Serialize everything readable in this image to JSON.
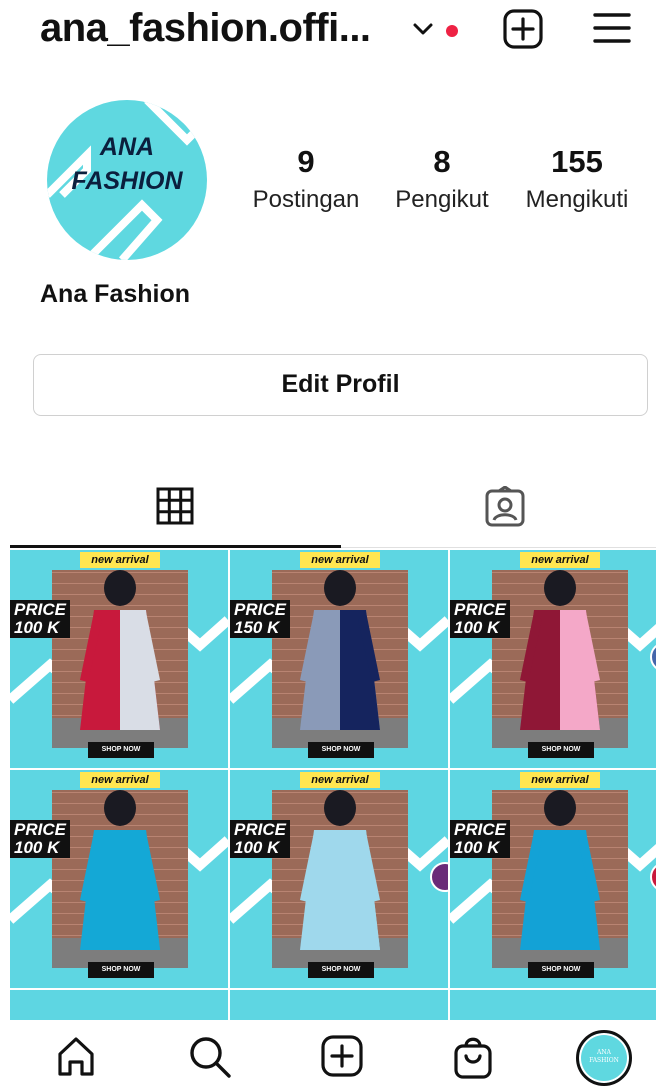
{
  "header": {
    "username": "ana_fashion.offi...",
    "chevron_icon": "chevron-down-icon",
    "notification_color": "#ee2244",
    "create_icon": "plus-square-icon",
    "menu_icon": "hamburger-menu-icon"
  },
  "profile": {
    "avatar_line1": "ANA",
    "avatar_line2": "FASHION",
    "avatar_color": "#5fd8e0",
    "display_name": "Ana Fashion",
    "stats": {
      "posts_count": "9",
      "posts_label": "Postingan",
      "followers_count": "8",
      "followers_label": "Pengikut",
      "following_count": "155",
      "following_label": "Mengikuti"
    },
    "edit_button": "Edit Profil"
  },
  "tabs": [
    {
      "icon": "grid-icon",
      "active": true
    },
    {
      "icon": "tagged-person-icon",
      "active": false
    }
  ],
  "posts": [
    {
      "badge": "new arrival",
      "price_line1": "PRICE",
      "price_line2": "100 K",
      "cta": "SHOP NOW",
      "dress_colors": [
        "#c8193c",
        "#d9dde6"
      ],
      "swatch": null
    },
    {
      "badge": "new arrival",
      "price_line1": "PRICE",
      "price_line2": "150 K",
      "cta": "SHOP NOW",
      "dress_colors": [
        "#8a9ab8",
        "#15245e"
      ],
      "swatch": null
    },
    {
      "badge": "new arrival",
      "price_line1": "PRICE",
      "price_line2": "100 K",
      "cta": "SHOP NOW",
      "dress_colors": [
        "#8f1736",
        "#f4a8c8"
      ],
      "swatch": "#4466aa"
    },
    {
      "badge": "new arrival",
      "price_line1": "PRICE",
      "price_line2": "100 K",
      "cta": "SHOP NOW",
      "dress_colors": [
        "#14a8d6",
        "#14a8d6"
      ],
      "swatch": null
    },
    {
      "badge": "new arrival",
      "price_line1": "PRICE",
      "price_line2": "100 K",
      "cta": "SHOP NOW",
      "dress_colors": [
        "#9fd8ec",
        "#9fd8ec"
      ],
      "swatch": "#6a2a78"
    },
    {
      "badge": "new arrival",
      "price_line1": "PRICE",
      "price_line2": "100 K",
      "cta": "SHOP NOW",
      "dress_colors": [
        "#13a2d6",
        "#13a2d6"
      ],
      "swatch": "#c8193c"
    }
  ],
  "bottom_nav": {
    "home_icon": "home-icon",
    "search_icon": "search-icon",
    "create_icon": "plus-square-icon",
    "shop_icon": "shopping-bag-icon",
    "profile_line1": "ANA",
    "profile_line2": "FASHION"
  }
}
